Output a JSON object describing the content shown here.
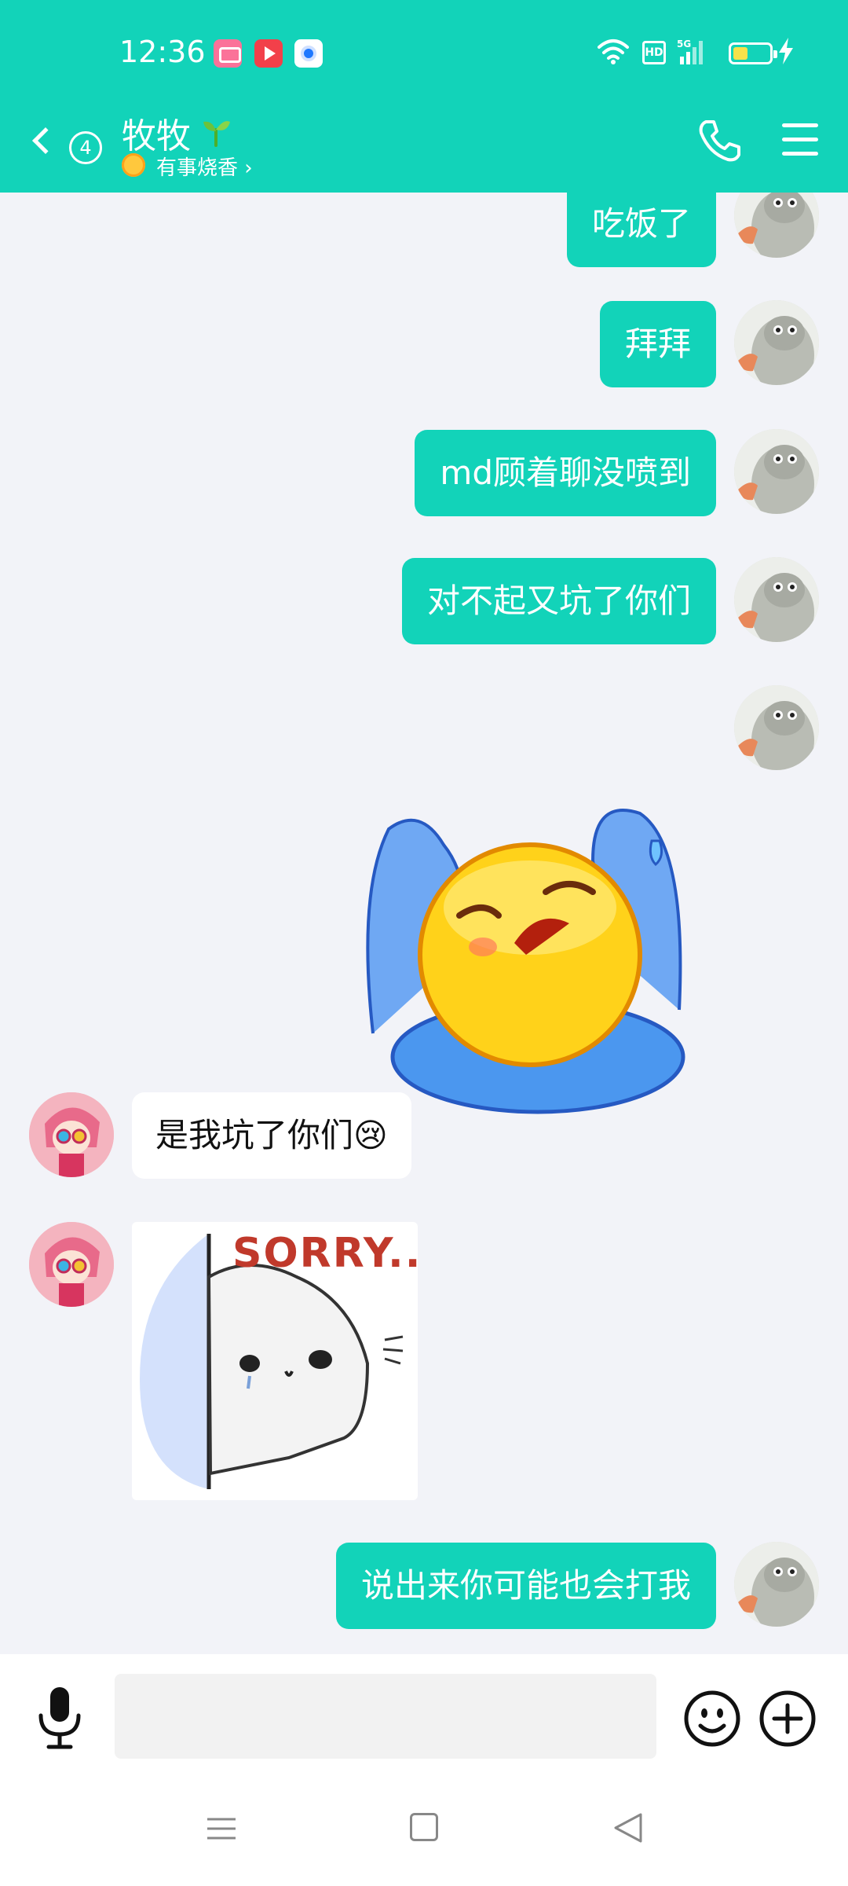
{
  "status_bar": {
    "time": "12:36",
    "icons": [
      "bilibili-app-icon",
      "video-app-icon",
      "browser-app-icon",
      "wifi-icon",
      "hd-icon",
      "5g-signal-icon",
      "battery-icon",
      "charging-icon"
    ],
    "hd_label": "HD",
    "battery_level": 0.3
  },
  "header": {
    "unread_count": "4",
    "contact_name": "牧牧",
    "status_text": "有事烧香 ›",
    "accent": "#12d3b9"
  },
  "messages": [
    {
      "side": "out",
      "type": "text",
      "text": "吃饭了"
    },
    {
      "side": "out",
      "type": "text",
      "text": "拜拜"
    },
    {
      "side": "out",
      "type": "text",
      "text": "md顾着聊没喷到"
    },
    {
      "side": "out",
      "type": "text",
      "text": "对不起又坑了你们"
    },
    {
      "side": "out",
      "type": "sticker",
      "sticker": "crying-emoji-sticker"
    },
    {
      "side": "in",
      "type": "text",
      "text": "是我坑了你们😢"
    },
    {
      "side": "in",
      "type": "sticker",
      "sticker": "sorry-seal-sticker",
      "sticker_text": "SORRY..."
    },
    {
      "side": "out",
      "type": "text",
      "text": "说出来你可能也会打我"
    }
  ],
  "input": {
    "placeholder": "",
    "value": ""
  }
}
